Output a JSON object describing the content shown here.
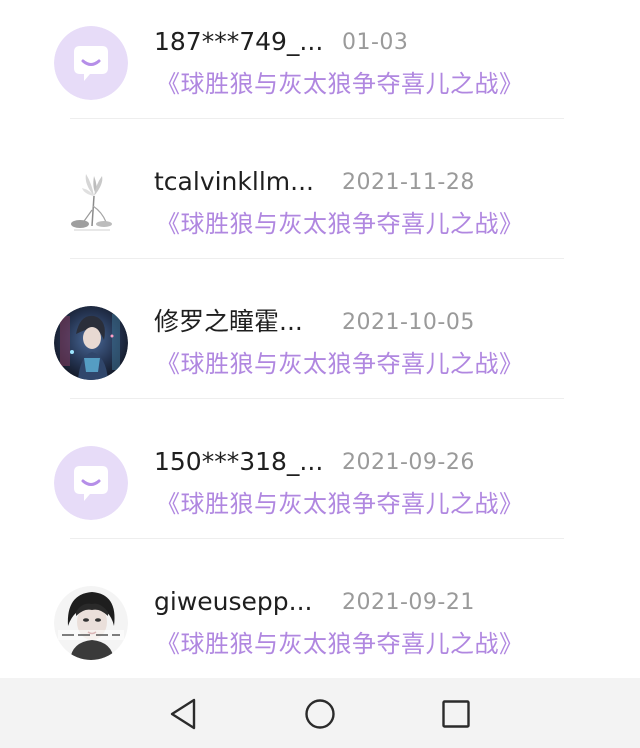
{
  "comments": [
    {
      "name": "187***749_...",
      "date": "01-03",
      "work_title": "《球胜狼与灰太狼争夺喜儿之战》",
      "avatar": "default-chat-bubble-avatar"
    },
    {
      "name": "tcalvinkllm...",
      "date": "2021-11-28",
      "work_title": "《球胜狼与灰太狼争夺喜儿之战》",
      "avatar": "lotus-flower-avatar"
    },
    {
      "name": "修罗之瞳霍...",
      "date": "2021-10-05",
      "work_title": "《球胜狼与灰太狼争夺喜儿之战》",
      "avatar": "anime-character-avatar"
    },
    {
      "name": "150***318_...",
      "date": "2021-09-26",
      "work_title": "《球胜狼与灰太狼争夺喜儿之战》",
      "avatar": "default-chat-bubble-avatar"
    },
    {
      "name": "giweusepp...",
      "date": "2021-09-21",
      "work_title": "《球胜狼与灰太狼争夺喜儿之战》",
      "avatar": "portrait-photo-avatar"
    }
  ],
  "navbar": {
    "icons": [
      "back-triangle-icon",
      "home-circle-icon",
      "recents-square-icon"
    ]
  },
  "colors": {
    "accent": "#b087e0",
    "default_avatar_bg": "#e7dcf8",
    "default_avatar_fg": "#b58ee8",
    "name_text": "#1f1f1f",
    "date_text": "#9a9a9a",
    "navbar_bg": "#f3f3f3"
  }
}
